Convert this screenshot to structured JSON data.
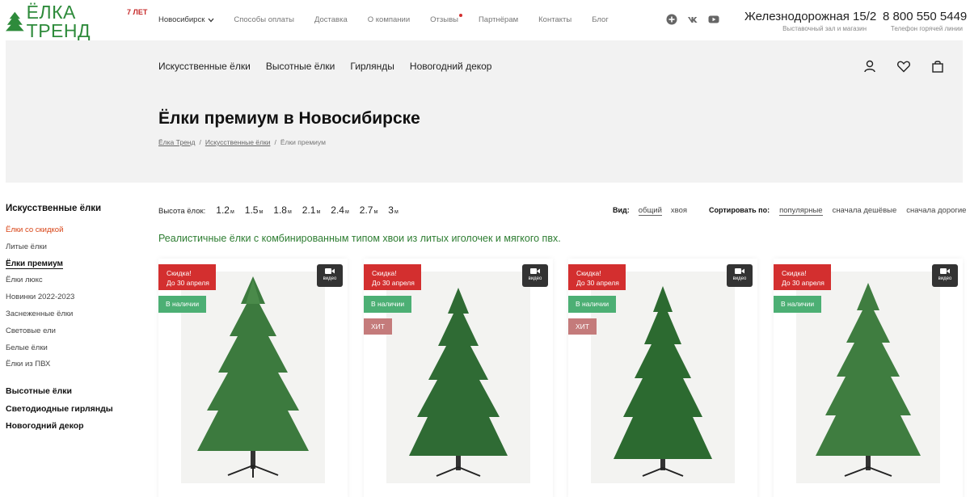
{
  "header": {
    "logo_text": "ЁЛКА ТРЕНД",
    "logo_badge": "7 ЛЕТ",
    "city": "Новосибирск",
    "nav": [
      "Способы оплаты",
      "Доставка",
      "О компании",
      "Отзывы",
      "Партнёрам",
      "Контакты",
      "Блог"
    ],
    "address": "Железнодорожная 15/2",
    "address_sub": "Выставочный зал и магазин",
    "phone": "8 800 550 5449",
    "phone_sub": "Телефон горячей линии"
  },
  "main_nav": [
    "Искусственные ёлки",
    "Высотные ёлки",
    "Гирлянды",
    "Новогодний декор"
  ],
  "page": {
    "title": "Ёлки премиум в Новосибирске",
    "breadcrumb": [
      "Ёлка Тренд",
      "Искусственные ёлки",
      "Ёлки премиум"
    ]
  },
  "sidebar": {
    "heading": "Искусственные ёлки",
    "items": [
      "Ёлки со скидкой",
      "Литые ёлки",
      "Ёлки премиум",
      "Ёлки люкс",
      "Новинки 2022-2023",
      "Заснеженные ёлки",
      "Световые ели",
      "Белые ёлки",
      "Ёлки из ПВХ"
    ],
    "categories": [
      "Высотные ёлки",
      "Светодиодные гирлянды",
      "Новогодний декор"
    ]
  },
  "filters": {
    "height_label": "Высота ёлок:",
    "heights": [
      "1.2",
      "1.5",
      "1.8",
      "2.1",
      "2.4",
      "2.7",
      "3"
    ],
    "unit": "м",
    "view_label": "Вид:",
    "view_options": [
      "общий",
      "хвоя"
    ],
    "sort_label": "Сортировать по:",
    "sort_options": [
      "популярные",
      "сначала дешёвые",
      "сначала дорогие"
    ]
  },
  "tagline": "Реалистичные ёлки с комбинированным типом хвои из литых иголочек и мягкого пвх.",
  "products": [
    {
      "sale_title": "Скидка!",
      "sale_sub": "До 30 апреля",
      "video": "видео",
      "stock": "В наличии",
      "hit": ""
    },
    {
      "sale_title": "Скидка!",
      "sale_sub": "До 30 апреля",
      "video": "видео",
      "stock": "В наличии",
      "hit": "ХИТ"
    },
    {
      "sale_title": "Скидка!",
      "sale_sub": "До 30 апреля",
      "video": "видео",
      "stock": "В наличии",
      "hit": "ХИТ"
    },
    {
      "sale_title": "Скидка!",
      "sale_sub": "До 30 апреля",
      "video": "видео",
      "stock": "В наличии",
      "hit": ""
    }
  ],
  "icons": {
    "logo": "tree-logo-icon",
    "city_chevron": "chevron-down-icon",
    "socials": [
      "odnoklassniki-icon",
      "vk-icon",
      "youtube-icon"
    ],
    "band": [
      "user-icon",
      "heart-icon",
      "bag-icon"
    ],
    "video": "video-camera-icon"
  },
  "colors": {
    "brand_green": "#2e8b3b",
    "sale_red": "#d32f2f",
    "stock_green": "#4caf74",
    "hit_pink": "#c47b7b",
    "band_grey": "#f2f2f2"
  }
}
